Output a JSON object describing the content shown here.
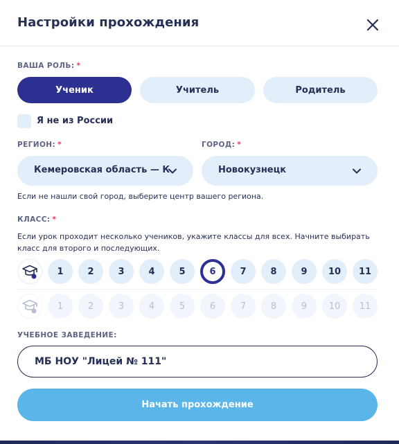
{
  "header": {
    "title": "Настройки прохождения",
    "close_icon": "close-icon"
  },
  "role": {
    "label": "ВАША РОЛЬ:",
    "required_mark": "*",
    "options": [
      "Ученик",
      "Учитель",
      "Родитель"
    ],
    "selected": "Ученик"
  },
  "not_russia": {
    "label": "Я не из России",
    "checked": false
  },
  "region": {
    "label": "РЕГИОН:",
    "required_mark": "*",
    "value": "Кемеровская область — Куз..."
  },
  "city": {
    "label": "ГОРОД:",
    "required_mark": "*",
    "value": "Новокузнецк"
  },
  "city_hint": "Если не нашли свой город, выберите центр вашего региона.",
  "grade": {
    "label": "КЛАСС:",
    "required_mark": "*",
    "hint_line1": "Если урок проходит несколько учеников, укажите классы для всех. Начните выбирать",
    "hint_line2": "класс для второго и последующих.",
    "primary": [
      "1",
      "2",
      "3",
      "4",
      "5",
      "6",
      "7",
      "8",
      "9",
      "10",
      "11"
    ],
    "primary_selected": "6",
    "secondary": [
      "1",
      "2",
      "3",
      "4",
      "5",
      "6",
      "7",
      "8",
      "9",
      "10",
      "11"
    ]
  },
  "school": {
    "label": "УЧЕБНОЕ ЗАВЕДЕНИЕ:",
    "value": "МБ НОУ \"Лицей № 111\""
  },
  "start_button": "Начать прохождение",
  "colors": {
    "primary": "#2c3090",
    "light": "#e3eefb",
    "accent": "#5ab5e8",
    "required": "#e8385c",
    "text": "#262f56"
  }
}
